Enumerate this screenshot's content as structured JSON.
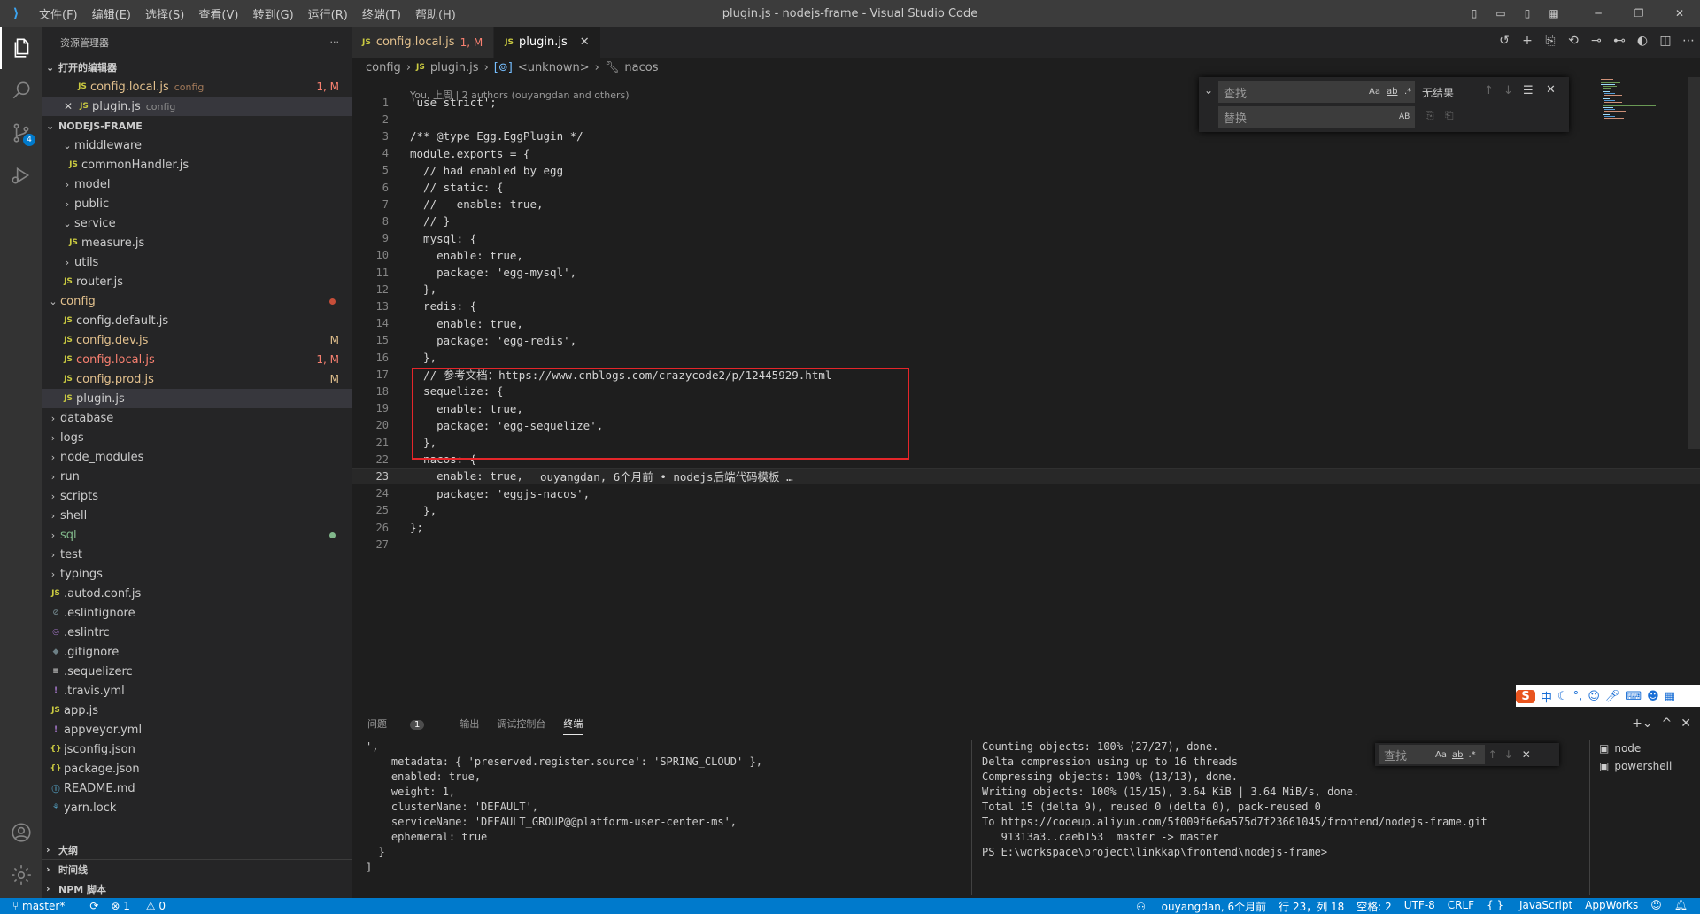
{
  "window": {
    "title": "plugin.js - nodejs-frame - Visual Studio Code",
    "menu": [
      "文件(F)",
      "编辑(E)",
      "选择(S)",
      "查看(V)",
      "转到(G)",
      "运行(R)",
      "终端(T)",
      "帮助(H)"
    ]
  },
  "activity": {
    "scm_badge": "4"
  },
  "sidebar": {
    "title": "资源管理器",
    "more": "···",
    "open_editors_title": "打开的编辑器",
    "open_editors": [
      {
        "name": "config.local.js",
        "folder": "config",
        "status": "1, M"
      },
      {
        "name": "plugin.js",
        "folder": "config",
        "status": ""
      }
    ],
    "project_title": "NODEJS-FRAME",
    "tree": [
      {
        "label": "middleware",
        "status": ""
      },
      {
        "label": "commonHandler.js",
        "status": ""
      },
      {
        "label": "model",
        "status": ""
      },
      {
        "label": "public",
        "status": ""
      },
      {
        "label": "service",
        "status": ""
      },
      {
        "label": "measure.js",
        "status": ""
      },
      {
        "label": "utils",
        "status": ""
      },
      {
        "label": "router.js",
        "status": ""
      },
      {
        "label": "config",
        "status": ""
      },
      {
        "label": "config.default.js",
        "status": ""
      },
      {
        "label": "config.dev.js",
        "status": "M"
      },
      {
        "label": "config.local.js",
        "status": "1, M"
      },
      {
        "label": "config.prod.js",
        "status": "M"
      },
      {
        "label": "plugin.js",
        "status": ""
      },
      {
        "label": "database",
        "status": ""
      },
      {
        "label": "logs",
        "status": ""
      },
      {
        "label": "node_modules",
        "status": ""
      },
      {
        "label": "run",
        "status": ""
      },
      {
        "label": "scripts",
        "status": ""
      },
      {
        "label": "shell",
        "status": ""
      },
      {
        "label": "sql",
        "status": ""
      },
      {
        "label": "test",
        "status": ""
      },
      {
        "label": "typings",
        "status": ""
      },
      {
        "label": ".autod.conf.js",
        "status": ""
      },
      {
        "label": ".eslintignore",
        "status": ""
      },
      {
        "label": ".eslintrc",
        "status": ""
      },
      {
        "label": ".gitignore",
        "status": ""
      },
      {
        "label": ".sequelizerc",
        "status": ""
      },
      {
        "label": ".travis.yml",
        "status": ""
      },
      {
        "label": "app.js",
        "status": ""
      },
      {
        "label": "appveyor.yml",
        "status": ""
      },
      {
        "label": "jsconfig.json",
        "status": ""
      },
      {
        "label": "package.json",
        "status": ""
      },
      {
        "label": "README.md",
        "status": ""
      },
      {
        "label": "yarn.lock",
        "status": ""
      }
    ],
    "bottom_sections": [
      "大纲",
      "时间线",
      "NPM 脚本"
    ]
  },
  "tabs": [
    {
      "label": "config.local.js",
      "status": "1, M"
    },
    {
      "label": "plugin.js",
      "status": ""
    }
  ],
  "breadcrumb": [
    "config",
    "plugin.js",
    "<unknown>",
    "nacos"
  ],
  "editor": {
    "blame_header": "You, 上周 | 2 authors (ouyangdan and others)",
    "line_numbers": [
      "1",
      "2",
      "3",
      "4",
      "5",
      "6",
      "7",
      "8",
      "9",
      "10",
      "11",
      "12",
      "13",
      "14",
      "15",
      "16",
      "17",
      "18",
      "19",
      "20",
      "21",
      "22",
      "23",
      "24",
      "25",
      "26",
      "27"
    ],
    "lines": [
      "'use strict';",
      "",
      "/** @type Egg.EggPlugin */",
      "module.exports = {",
      "  // had enabled by egg",
      "  // static: {",
      "  //   enable: true,",
      "  // }",
      "  mysql: {",
      "    enable: true,",
      "    package: 'egg-mysql',",
      "  },",
      "  redis: {",
      "    enable: true,",
      "    package: 'egg-redis',",
      "  },",
      "  // 参考文档：https://www.cnblogs.com/crazycode2/p/12445929.html",
      "  sequelize: {",
      "    enable: true,",
      "    package: 'egg-sequelize',",
      "  },",
      "  nacos: {",
      "    enable: true,",
      "    package: 'eggjs-nacos',",
      "  },",
      "};",
      ""
    ],
    "inline_blame": "ouyangdan, 6个月前 • nodejs后端代码模板 …",
    "current_line": 23
  },
  "find_widget": {
    "find_placeholder": "查找",
    "replace_placeholder": "替换",
    "result": "无结果",
    "opt_case": "Aa",
    "opt_word": "ab",
    "opt_regex": ".*",
    "opt_preserve": "AB"
  },
  "ime": {
    "label": "中"
  },
  "panel": {
    "tabs": [
      "问题",
      "输出",
      "调试控制台",
      "终端"
    ],
    "problems_count": "1",
    "terminal_left": [
      "',",
      "    metadata: { 'preserved.register.source': 'SPRING_CLOUD' },",
      "    enabled: true,",
      "    weight: 1,",
      "    clusterName: 'DEFAULT',",
      "    serviceName: 'DEFAULT_GROUP@@platform-user-center-ms',",
      "    ephemeral: true",
      "  }",
      "]",
      ""
    ],
    "terminal_right": [
      "Counting objects: 100% (27/27), done.",
      "Delta compression using up to 16 threads",
      "Compressing objects: 100% (13/13), done.",
      "Writing objects: 100% (15/15), 3.64 KiB | 3.64 MiB/s, done.",
      "Total 15 (delta 9), reused 0 (delta 0), pack-reused 0",
      "To https://codeup.aliyun.com/5f009f6e6a575d7f23661045/frontend/nodejs-frame.git",
      "   91313a3..caeb153  master -> master",
      "PS E:\\workspace\\project\\linkkap\\frontend\\nodejs-frame> "
    ],
    "term_find_placeholder": "查找",
    "terminals": [
      "node",
      "powershell"
    ]
  },
  "statusbar": {
    "branch": "master*",
    "errors": "1",
    "warnings": "0",
    "blame": "ouyangdan, 6个月前",
    "position": "行 23，列 18",
    "spaces": "空格: 2",
    "encoding": "UTF-8",
    "eol": "CRLF",
    "language": "JavaScript",
    "appworks": "AppWorks"
  }
}
